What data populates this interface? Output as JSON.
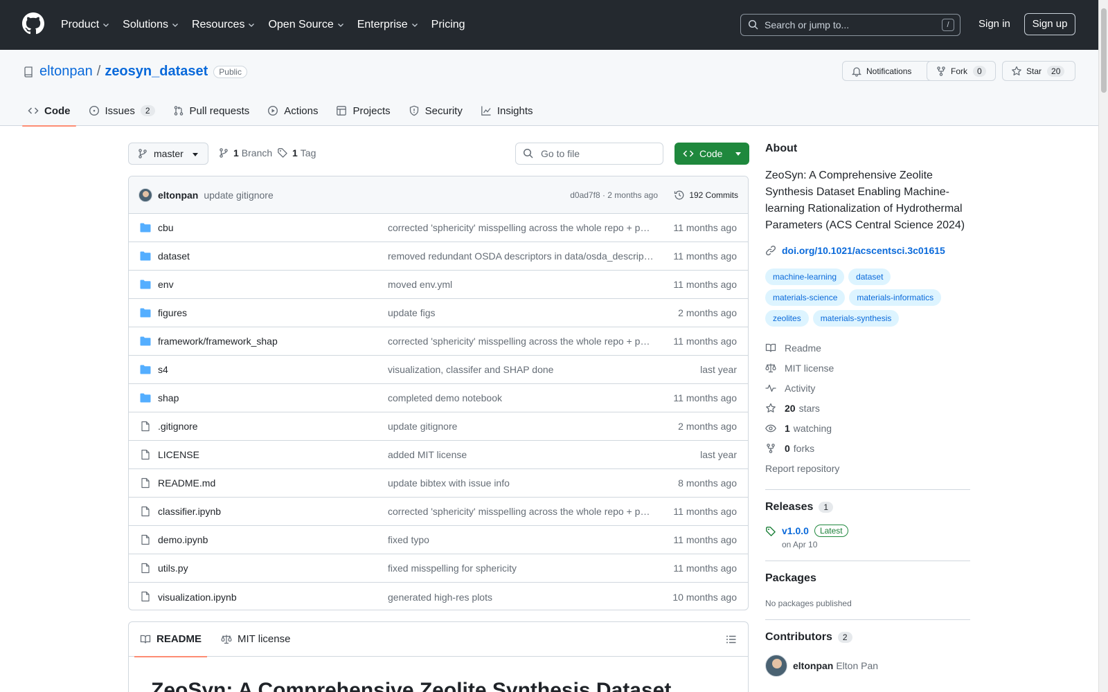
{
  "header": {
    "nav": [
      {
        "label": "Product",
        "dropdown": true
      },
      {
        "label": "Solutions",
        "dropdown": true
      },
      {
        "label": "Resources",
        "dropdown": true
      },
      {
        "label": "Open Source",
        "dropdown": true
      },
      {
        "label": "Enterprise",
        "dropdown": true
      },
      {
        "label": "Pricing",
        "dropdown": false
      }
    ],
    "search_placeholder": "Search or jump to...",
    "search_shortcut": "/",
    "sign_in": "Sign in",
    "sign_up": "Sign up"
  },
  "repo": {
    "owner": "eltonpan",
    "separator": "/",
    "name": "zeosyn_dataset",
    "visibility": "Public",
    "notifications_label": "Notifications",
    "fork_label": "Fork",
    "fork_count": "0",
    "star_label": "Star",
    "star_count": "20",
    "tabs": [
      {
        "label": "Code",
        "icon": "code-icon",
        "count": null,
        "active": true
      },
      {
        "label": "Issues",
        "icon": "issue-icon",
        "count": "2",
        "active": false
      },
      {
        "label": "Pull requests",
        "icon": "pull-request-icon",
        "count": null,
        "active": false
      },
      {
        "label": "Actions",
        "icon": "play-icon",
        "count": null,
        "active": false
      },
      {
        "label": "Projects",
        "icon": "table-icon",
        "count": null,
        "active": false
      },
      {
        "label": "Security",
        "icon": "shield-icon",
        "count": null,
        "active": false
      },
      {
        "label": "Insights",
        "icon": "graph-icon",
        "count": null,
        "active": false
      }
    ]
  },
  "controls": {
    "branch": "master",
    "branches_count": "1",
    "branches_label": "Branch",
    "tags_count": "1",
    "tags_label": "Tag",
    "goto_placeholder": "Go to file",
    "code_button": "Code"
  },
  "latest_commit": {
    "author": "eltonpan",
    "message": "update gitignore",
    "hash_time": "d0ad7f8 · 2 months ago",
    "commits_label": "192 Commits"
  },
  "files": [
    {
      "name": "cbu",
      "type": "dir",
      "message": "corrected 'sphericity' misspelling across the whole repo + p…",
      "date": "11 months ago"
    },
    {
      "name": "dataset",
      "type": "dir",
      "message": "removed redundant OSDA descriptors in data/osda_descrip…",
      "date": "11 months ago"
    },
    {
      "name": "env",
      "type": "dir",
      "message": "moved env.yml",
      "date": "11 months ago"
    },
    {
      "name": "figures",
      "type": "dir",
      "message": "update figs",
      "date": "2 months ago"
    },
    {
      "name": "framework/framework_shap",
      "type": "dir",
      "message": "corrected 'sphericity' misspelling across the whole repo + p…",
      "date": "11 months ago"
    },
    {
      "name": "s4",
      "type": "dir",
      "message": "visualization, classifer and SHAP done",
      "date": "last year"
    },
    {
      "name": "shap",
      "type": "dir",
      "message": "completed demo notebook",
      "date": "11 months ago"
    },
    {
      "name": ".gitignore",
      "type": "file",
      "message": "update gitignore",
      "date": "2 months ago"
    },
    {
      "name": "LICENSE",
      "type": "file",
      "message": "added MIT license",
      "date": "last year"
    },
    {
      "name": "README.md",
      "type": "file",
      "message": "update bibtex with issue info",
      "date": "8 months ago"
    },
    {
      "name": "classifier.ipynb",
      "type": "file",
      "message": "corrected 'sphericity' misspelling across the whole repo + p…",
      "date": "11 months ago"
    },
    {
      "name": "demo.ipynb",
      "type": "file",
      "message": "fixed typo",
      "date": "11 months ago"
    },
    {
      "name": "utils.py",
      "type": "file",
      "message": "fixed misspelling for sphericity",
      "date": "11 months ago"
    },
    {
      "name": "visualization.ipynb",
      "type": "file",
      "message": "generated high-res plots",
      "date": "10 months ago"
    }
  ],
  "readme": {
    "tab_readme": "README",
    "tab_license": "MIT license",
    "heading": "ZeoSyn: A Comprehensive Zeolite Synthesis Dataset"
  },
  "sidebar": {
    "about_title": "About",
    "description": "ZeoSyn: A Comprehensive Zeolite Synthesis Dataset Enabling Machine-learning Rationalization of Hydrothermal Parameters (ACS Central Science 2024)",
    "doi": "doi.org/10.1021/acscentsci.3c01615",
    "topics": [
      "machine-learning",
      "dataset",
      "materials-science",
      "materials-informatics",
      "zeolites",
      "materials-synthesis"
    ],
    "links": [
      {
        "icon": "book-icon",
        "bold": "",
        "label": "Readme"
      },
      {
        "icon": "law-icon",
        "bold": "",
        "label": "MIT license"
      },
      {
        "icon": "pulse-icon",
        "bold": "",
        "label": "Activity"
      },
      {
        "icon": "star-icon",
        "bold": "20",
        "label": "stars"
      },
      {
        "icon": "eye-icon",
        "bold": "1",
        "label": "watching"
      },
      {
        "icon": "fork-icon",
        "bold": "0",
        "label": "forks"
      }
    ],
    "report": "Report repository",
    "releases_title": "Releases",
    "releases_count": "1",
    "release_version": "v1.0.0",
    "release_badge": "Latest",
    "release_date": "on Apr 10",
    "packages_title": "Packages",
    "packages_empty": "No packages published",
    "contributors_title": "Contributors",
    "contributors_count": "2",
    "contributor_login": "eltonpan",
    "contributor_name": "Elton Pan"
  },
  "colors": {
    "header_bg": "#24292f",
    "link": "#0969da",
    "primary_button": "#1f883d",
    "tab_underline": "#fd8c73",
    "folder": "#54aeff"
  }
}
